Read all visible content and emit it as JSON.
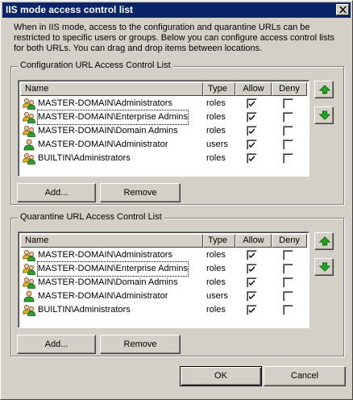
{
  "window": {
    "title": "IIS mode access control list",
    "close_glyph": "×"
  },
  "intro_text": "When in IIS mode, access to the configuration and quarantine URLs can be restricted to specific users or groups. Below you can configure access control lists for both URLs. You can drag and drop items between locations.",
  "columns": {
    "name": "Name",
    "type": "Type",
    "allow": "Allow",
    "deny": "Deny"
  },
  "configuration": {
    "label": "Configuration URL Access Control List",
    "rows": [
      {
        "name": "MASTER-DOMAIN\\Administrators",
        "type": "roles",
        "allow": true,
        "deny": false,
        "icon": "group-icon"
      },
      {
        "name": "MASTER-DOMAIN\\Enterprise Admins",
        "type": "roles",
        "allow": true,
        "deny": false,
        "icon": "group-icon"
      },
      {
        "name": "MASTER-DOMAIN\\Domain Admins",
        "type": "roles",
        "allow": true,
        "deny": false,
        "icon": "group-icon"
      },
      {
        "name": "MASTER-DOMAIN\\Administrator",
        "type": "users",
        "allow": true,
        "deny": false,
        "icon": "user-icon"
      },
      {
        "name": "BUILTIN\\Administrators",
        "type": "roles",
        "allow": true,
        "deny": false,
        "icon": "group-icon"
      }
    ],
    "add_label": "Add...",
    "remove_label": "Remove"
  },
  "quarantine": {
    "label": "Quarantine URL Access Control List",
    "rows": [
      {
        "name": "MASTER-DOMAIN\\Administrators",
        "type": "roles",
        "allow": true,
        "deny": false,
        "icon": "group-icon"
      },
      {
        "name": "MASTER-DOMAIN\\Enterprise Admins",
        "type": "roles",
        "allow": true,
        "deny": false,
        "icon": "group-icon"
      },
      {
        "name": "MASTER-DOMAIN\\Domain Admins",
        "type": "roles",
        "allow": true,
        "deny": false,
        "icon": "group-icon"
      },
      {
        "name": "MASTER-DOMAIN\\Administrator",
        "type": "users",
        "allow": true,
        "deny": false,
        "icon": "user-icon"
      },
      {
        "name": "BUILTIN\\Administrators",
        "type": "roles",
        "allow": true,
        "deny": false,
        "icon": "group-icon"
      }
    ],
    "add_label": "Add...",
    "remove_label": "Remove"
  },
  "footer": {
    "ok_label": "OK",
    "cancel_label": "Cancel"
  },
  "colors": {
    "title_bar": "#0a246a",
    "face": "#d4d0c8",
    "arrow_green": "#1ea81e"
  }
}
